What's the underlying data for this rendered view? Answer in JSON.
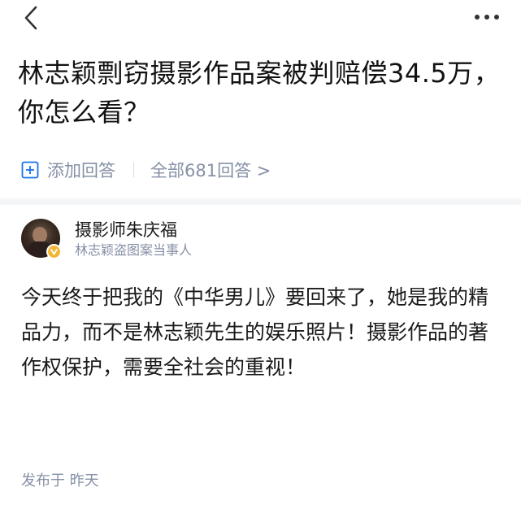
{
  "nav": {
    "back_icon": "chevron-left-icon",
    "more_icon": "more-horizontal-icon"
  },
  "question": {
    "title": "林志颖剽窃摄影作品案被判赔偿34.5万，你怎么看？"
  },
  "actions": {
    "add_answer_label": "添加回答",
    "add_answer_icon": "plus-square-icon",
    "all_answers_label": "全部681回答 >"
  },
  "answer": {
    "author_name": "摄影师朱庆福",
    "author_desc": "林志颖盗图案当事人",
    "verified_badge_color": "#f2b635",
    "content": "今天终于把我的《中华男儿》要回来了，她是我的精品力，而不是林志颖先生的娱乐照片！摄影作品的著作权保护，需要全社会的重视！",
    "published": "发布于 昨天"
  }
}
